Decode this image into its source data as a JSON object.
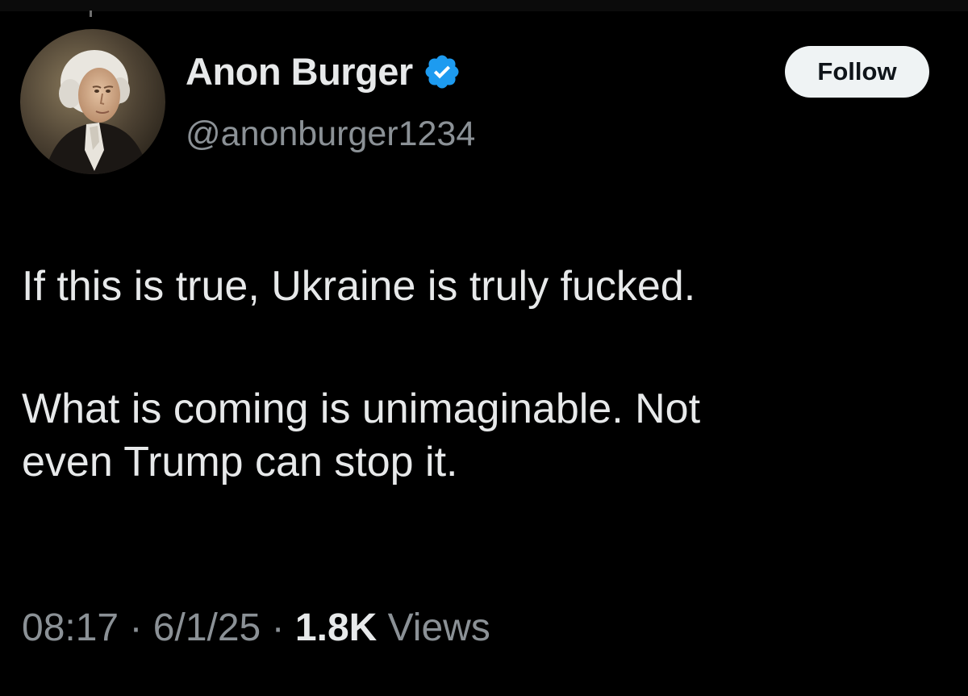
{
  "post": {
    "author": {
      "display_name": "Anon Burger",
      "handle": "@anonburger1234",
      "verified": true,
      "verified_badge_icon": "verified-badge-icon",
      "avatar_icon": "portrait-avatar"
    },
    "follow_label": "Follow",
    "text_paragraphs": [
      "If this is true, Ukraine is truly fucked.",
      "What is coming is unimaginable. Not",
      "even Trump can stop it."
    ],
    "time": "08:17",
    "separator": "·",
    "date": "6/1/25",
    "views_count": "1.8K",
    "views_label": "Views"
  },
  "colors": {
    "background": "#000000",
    "primary_text": "#e7e9ea",
    "secondary_text": "#8b9196",
    "verified_blue": "#1d9bf0",
    "follow_button_bg": "#eff3f4",
    "follow_button_text": "#0f1419"
  }
}
